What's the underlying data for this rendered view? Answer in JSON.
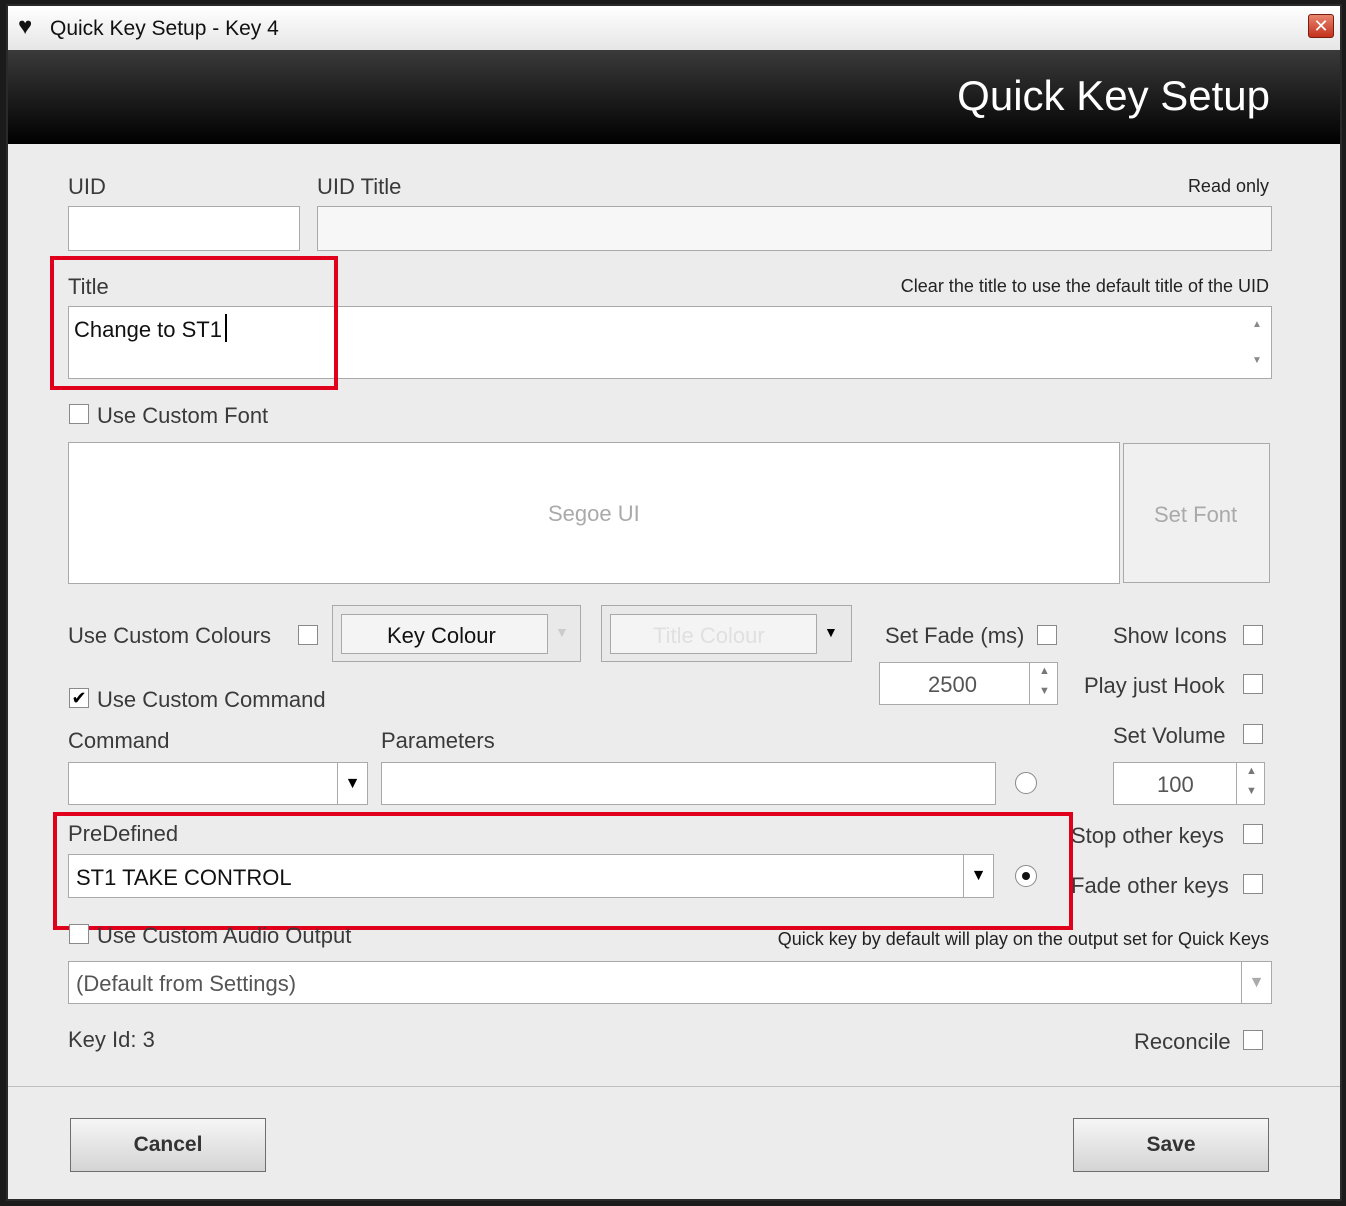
{
  "window": {
    "title": "Quick Key Setup - Key 4",
    "close_glyph": "✕"
  },
  "header": {
    "title": "Quick Key Setup"
  },
  "uid": {
    "label": "UID",
    "value": ""
  },
  "uid_title": {
    "label": "UID Title",
    "value": "",
    "note": "Read only"
  },
  "title_field": {
    "label": "Title",
    "value": "Change to ST1",
    "hint": "Clear the title to use the default title of the UID"
  },
  "custom_font": {
    "label": "Use Custom Font",
    "checked": false,
    "font_preview": "Segoe UI",
    "set_font_label": "Set Font"
  },
  "custom_colours": {
    "label": "Use Custom Colours",
    "checked": false,
    "key_colour_label": "Key Colour",
    "title_colour_label": "Title Colour"
  },
  "set_fade": {
    "label": "Set Fade (ms)",
    "checked": false,
    "value": "2500"
  },
  "show_icons": {
    "label": "Show Icons",
    "checked": false
  },
  "play_just_hook": {
    "label": "Play just Hook",
    "checked": false
  },
  "set_volume": {
    "label": "Set Volume",
    "checked": false,
    "value": "100"
  },
  "custom_command": {
    "label": "Use Custom Command",
    "checked": true
  },
  "command": {
    "label": "Command",
    "value": ""
  },
  "parameters": {
    "label": "Parameters",
    "value": ""
  },
  "predefined": {
    "label": "PreDefined",
    "value": "ST1 TAKE CONTROL"
  },
  "stop_other_keys": {
    "label": "Stop other keys",
    "checked": false
  },
  "fade_other_keys": {
    "label": "Fade other keys",
    "checked": false
  },
  "audio_output": {
    "label": "Use Custom Audio Output",
    "checked": false,
    "hint": "Quick key by default will play on the output set for Quick Keys",
    "value": "(Default from Settings)"
  },
  "key_id": {
    "text": "Key Id: 3"
  },
  "reconcile": {
    "label": "Reconcile",
    "checked": false
  },
  "buttons": {
    "cancel": "Cancel",
    "save": "Save"
  },
  "icons": {
    "app": "♥",
    "dropdown": "▼",
    "spin_up": "▲",
    "spin_down": "▼",
    "check": "✔"
  },
  "colors": {
    "highlight": "#e0001b",
    "header_bg": "#000000",
    "dialog_bg": "#ececec"
  }
}
